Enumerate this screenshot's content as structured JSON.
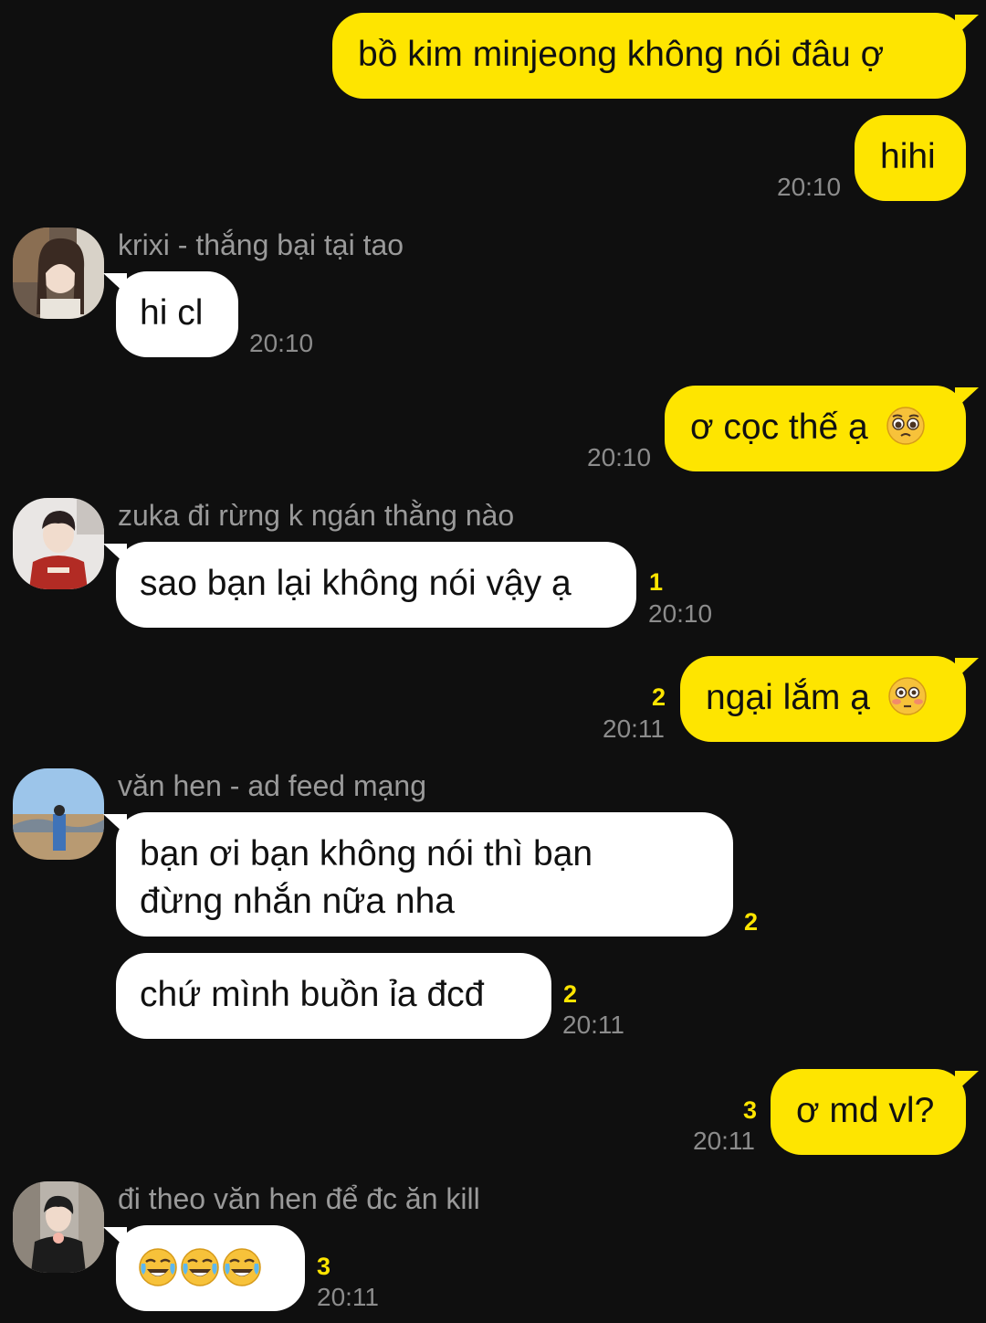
{
  "messages": {
    "m1": {
      "text": "bồ kim minjeong không nói đâu ợ"
    },
    "m2": {
      "text": "hihi",
      "time": "20:10"
    },
    "m3": {
      "sender": "krixi - thắng bại tại tao",
      "text": "hi cl",
      "time": "20:10"
    },
    "m4": {
      "text": "ơ cọc thế ạ",
      "emoji": "pleading-face-icon",
      "time": "20:10"
    },
    "m5": {
      "sender": "zuka đi rừng k ngán thằng nào",
      "text": "sao bạn lại không nói vậy ạ",
      "unread": "1",
      "time": "20:10"
    },
    "m6": {
      "text": "ngại lắm ạ",
      "emoji": "flushed-face-icon",
      "unread": "2",
      "time": "20:11"
    },
    "m7": {
      "sender": "văn hen - ad feed mạng",
      "line1": "bạn ơi bạn không nói thì bạn",
      "line2": "đừng nhắn nữa nha",
      "unread": "2"
    },
    "m8": {
      "text": "chứ mình buồn ỉa đcđ",
      "unread": "2",
      "time": "20:11"
    },
    "m9": {
      "text": "ơ md vl?",
      "unread": "3",
      "time": "20:11"
    },
    "m10": {
      "sender": "đi theo văn hen để đc ăn kill",
      "emoji": "tears-of-joy-icon",
      "unread": "3",
      "time": "20:11"
    }
  },
  "colors": {
    "background": "#0f0f0f",
    "my_bubble": "#fee500",
    "their_bubble": "#ffffff",
    "time_text": "#8c8c8c",
    "unread_count": "#fee500"
  }
}
